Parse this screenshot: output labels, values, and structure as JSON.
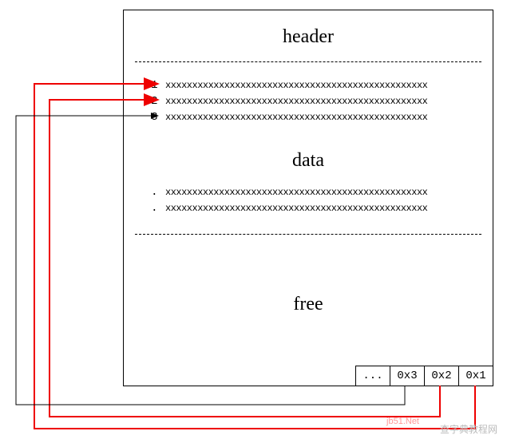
{
  "sections": {
    "header": "header",
    "data": "data",
    "free": "free"
  },
  "rows": [
    {
      "num": "1",
      "content": "xxxxxxxxxxxxxxxxxxxxxxxxxxxxxxxxxxxxxxxxxxxxxxxxx"
    },
    {
      "num": "2",
      "content": "xxxxxxxxxxxxxxxxxxxxxxxxxxxxxxxxxxxxxxxxxxxxxxxxx"
    },
    {
      "num": "3",
      "content": "xxxxxxxxxxxxxxxxxxxxxxxxxxxxxxxxxxxxxxxxxxxxxxxxx"
    },
    {
      "num": ".",
      "content": "xxxxxxxxxxxxxxxxxxxxxxxxxxxxxxxxxxxxxxxxxxxxxxxxx"
    },
    {
      "num": ".",
      "content": "xxxxxxxxxxxxxxxxxxxxxxxxxxxxxxxxxxxxxxxxxxxxxxxxx"
    }
  ],
  "offsets": [
    "...",
    "0x3",
    "0x2",
    "0x1"
  ],
  "watermark": "查字典教程网",
  "watermark2": "jb51.Net"
}
